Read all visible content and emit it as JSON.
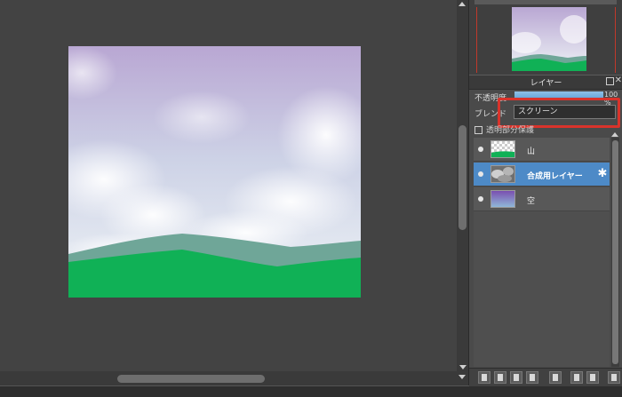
{
  "layer_panel": {
    "title": "レイヤー",
    "opacity_label": "不透明度",
    "opacity_value": "100 %",
    "opacity_level": 1.0,
    "blend_label": "ブレンド",
    "blend_mode": "スクリーン",
    "options_text": "透明部分保護",
    "layers": [
      {
        "name": "山",
        "thumb": "mountain",
        "selected": false
      },
      {
        "name": "合成用レイヤー",
        "thumb": "clouds",
        "selected": true
      },
      {
        "name": "空",
        "thumb": "sky",
        "selected": false
      }
    ]
  },
  "icons": {
    "layer_eye": "eye-icon",
    "layer_settings": "gear-icon",
    "toolbar": [
      "new-layer-icon",
      "new-layer-copy-icon",
      "new-layer-mask-icon",
      "add-layer-dropdown-icon",
      "folder-icon",
      "duplicate-icon",
      "merge-icon",
      "trash-icon"
    ]
  },
  "colors": {
    "highlight": "#d9332b",
    "selected_layer": "#4d8ac7",
    "mountain_front": "#10b156",
    "mountain_back": "#6fa698"
  }
}
